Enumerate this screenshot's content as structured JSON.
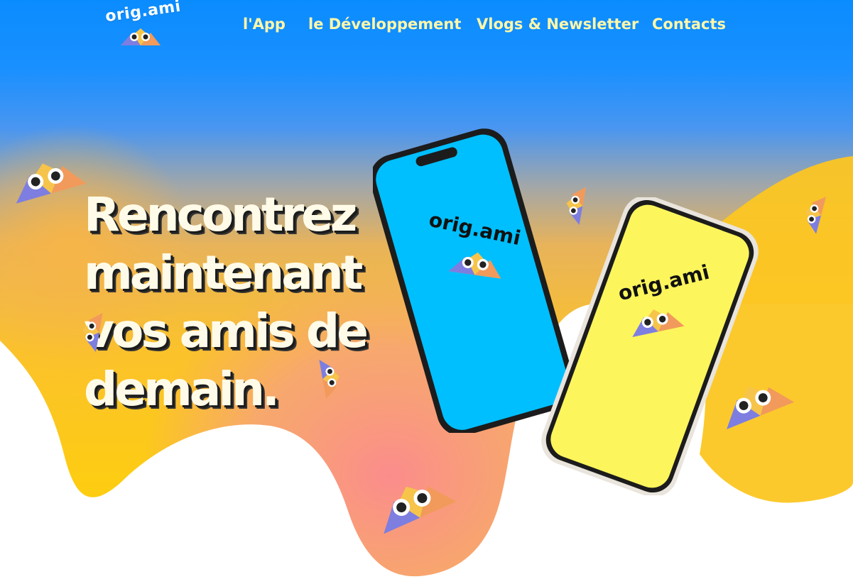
{
  "brand": {
    "logo_text": "orig.ami"
  },
  "nav": {
    "items": [
      {
        "label": "l'App"
      },
      {
        "label": "le Développement"
      },
      {
        "label": "Vlogs & Newsletter"
      },
      {
        "label": "Contacts"
      }
    ]
  },
  "hero": {
    "headline_lines": [
      "Rencontrez",
      "maintenant",
      "vos amis de",
      "demain."
    ]
  },
  "phones": {
    "left_screen_text": "orig.ami",
    "right_screen_text": "orig.ami"
  },
  "colors": {
    "sky": "#0a8cff",
    "nav_text": "#fff7a8",
    "yellow": "#ffd400",
    "orange": "#f5a43c",
    "pink": "#f98f8f",
    "phone_blue": "#00bfff",
    "phone_yellow": "#fdf55c"
  },
  "icons": [
    "logo-mascot-icon",
    "mascot-icon"
  ]
}
